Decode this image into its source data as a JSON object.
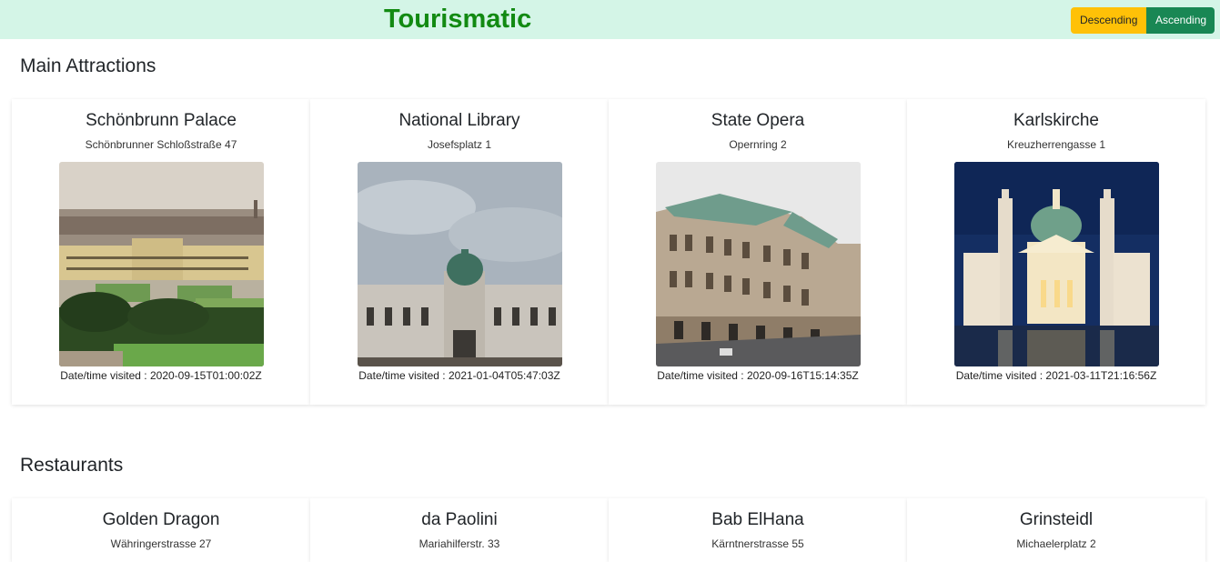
{
  "header": {
    "brand": "Tourismatic",
    "sort_descending": "Descending",
    "sort_ascending": "Ascending"
  },
  "attractions": {
    "title": "Main Attractions",
    "date_prefix": "Date/time visited : ",
    "items": [
      {
        "name": "Schönbrunn Palace",
        "address": "Schönbrunner Schloßstraße 47",
        "visited": "Date/time visited : 2020-09-15T01:00:02Z"
      },
      {
        "name": "National Library",
        "address": "Josefsplatz 1",
        "visited": "Date/time visited : 2021-01-04T05:47:03Z"
      },
      {
        "name": "State Opera",
        "address": "Opernring 2",
        "visited": "Date/time visited : 2020-09-16T15:14:35Z"
      },
      {
        "name": "Karlskirche",
        "address": "Kreuzherrengasse 1",
        "visited": "Date/time visited : 2021-03-11T21:16:56Z"
      }
    ]
  },
  "restaurants": {
    "title": "Restaurants",
    "items": [
      {
        "name": "Golden Dragon",
        "address": "Währingerstrasse 27"
      },
      {
        "name": "da Paolini",
        "address": "Mariahilferstr. 33"
      },
      {
        "name": "Bab ElHana",
        "address": "Kärntnerstrasse 55"
      },
      {
        "name": "Grinsteidl",
        "address": "Michaelerplatz 2"
      }
    ]
  }
}
